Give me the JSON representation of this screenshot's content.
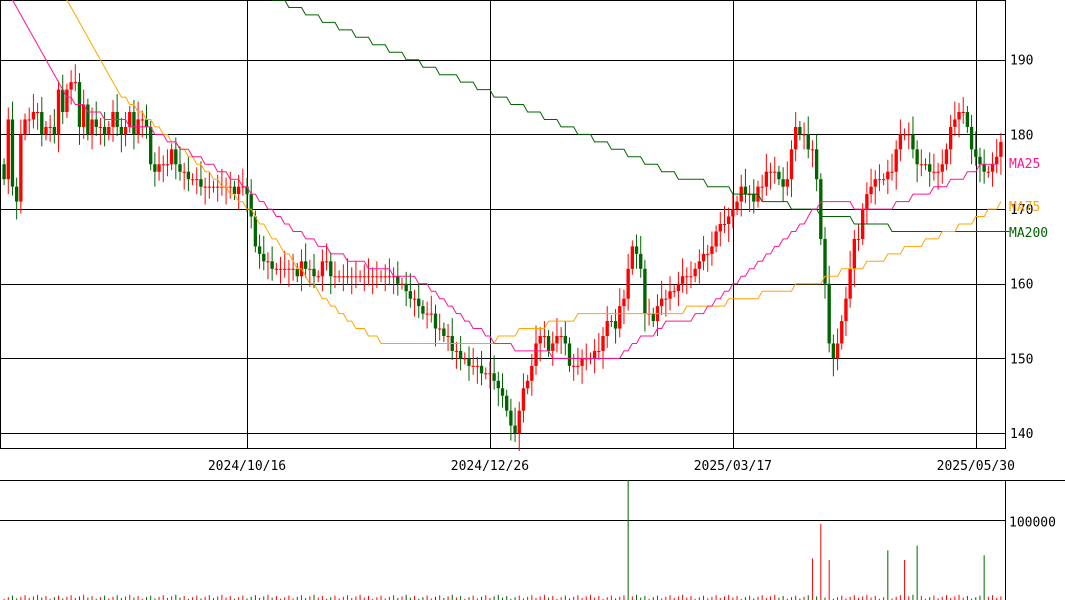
{
  "chart_data": [
    {
      "type": "candlestick",
      "panel": "price",
      "ylim": [
        138,
        198
      ],
      "y_ticks": [
        140,
        150,
        160,
        170,
        180,
        190
      ],
      "x_tick_labels": [
        {
          "index": 58,
          "label": "2024/10/16"
        },
        {
          "index": 116,
          "label": "2024/12/26"
        },
        {
          "index": 174,
          "label": "2025/03/17"
        },
        {
          "index": 232,
          "label": "2025/05/30"
        }
      ],
      "grid": true,
      "colors": {
        "up": "#ff0000",
        "down": "#006400",
        "ma25": "#ff1493",
        "ma75": "#ffa500",
        "ma200": "#006400",
        "grid": "#000000"
      },
      "legend": [
        {
          "label": "MA25",
          "color": "#ff1493"
        },
        {
          "label": "MA75",
          "color": "#ffa500"
        },
        {
          "label": "MA200",
          "color": "#006400"
        }
      ],
      "closes": [
        174,
        182,
        173,
        171,
        180,
        182,
        182,
        183,
        183,
        180,
        181,
        181,
        180,
        186,
        183,
        186,
        187,
        187,
        181,
        184,
        180,
        182,
        181,
        181,
        180,
        181,
        183,
        181,
        180,
        181,
        183,
        180,
        182,
        182,
        181,
        176,
        175,
        176,
        176,
        176,
        178,
        176,
        175,
        175,
        174,
        174,
        174,
        173,
        173,
        173,
        173,
        173,
        173,
        173,
        173,
        172,
        173,
        173,
        172,
        169,
        165,
        164,
        163,
        163,
        162,
        162,
        162,
        162,
        162,
        162,
        161,
        163,
        162,
        162,
        161,
        161,
        163,
        163,
        161,
        161,
        161,
        161,
        161,
        161,
        161,
        161,
        161,
        161,
        161,
        161,
        161,
        161,
        161,
        161,
        160,
        160,
        159,
        158,
        158,
        157,
        156,
        156,
        156,
        154,
        154,
        153,
        153,
        151,
        151,
        150,
        150,
        149,
        149,
        149,
        148,
        148,
        148,
        147,
        146,
        145,
        143,
        141,
        140,
        143,
        146,
        147,
        149,
        152,
        153,
        153,
        151,
        152,
        153,
        153,
        152,
        149,
        149,
        149,
        150,
        150,
        150,
        151,
        151,
        153,
        155,
        155,
        154,
        157,
        158,
        162,
        165,
        164,
        162,
        156,
        156,
        155,
        157,
        158,
        158,
        159,
        159,
        160,
        161,
        161,
        161,
        162,
        163,
        164,
        164,
        165,
        167,
        168,
        168,
        169,
        170,
        171,
        173,
        172,
        172,
        171,
        173,
        173,
        175,
        175,
        175,
        174,
        173,
        174,
        178,
        181,
        180,
        180,
        178,
        178,
        174,
        166,
        160,
        152,
        150,
        152,
        155,
        158,
        162,
        166,
        166,
        170,
        172,
        173,
        174,
        174,
        174,
        175,
        175,
        178,
        180,
        180,
        180,
        178,
        176,
        176,
        176,
        175,
        175,
        175,
        176,
        178,
        181,
        182,
        183,
        183,
        181,
        178,
        177,
        176,
        175,
        175,
        176,
        177,
        179
      ],
      "ohlc_sample": [
        {
          "o": 180,
          "h": 183,
          "l": 172,
          "c": 174
        },
        {
          "o": 183,
          "h": 187,
          "l": 170,
          "c": 182
        },
        {
          "o": 182,
          "h": 184,
          "l": 171,
          "c": 173
        },
        {
          "o": 173,
          "h": 176,
          "l": 169,
          "c": 171
        }
      ],
      "ma25": [
        200,
        199,
        198,
        197,
        196,
        195,
        194,
        193,
        192,
        191,
        190,
        189,
        188,
        187,
        186,
        185,
        185,
        184,
        184,
        184,
        183,
        183,
        183,
        183,
        182,
        182,
        182,
        182,
        182,
        182,
        181,
        181,
        181,
        181,
        181,
        181,
        180,
        180,
        180,
        179,
        179,
        179,
        178,
        178,
        178,
        177,
        177,
        177,
        176,
        176,
        176,
        175,
        175,
        175,
        174,
        174,
        174,
        173,
        173,
        172,
        172,
        171,
        171,
        170,
        170,
        169,
        169,
        168,
        168,
        167,
        167,
        167,
        166,
        166,
        166,
        165,
        165,
        165,
        164,
        164,
        164,
        164,
        163,
        163,
        163,
        163,
        163,
        162,
        162,
        162,
        162,
        162,
        162,
        161,
        161,
        161,
        161,
        161,
        161,
        160,
        160,
        160,
        159,
        159,
        158,
        158,
        157,
        157,
        156,
        156,
        155,
        155,
        154,
        154,
        154,
        153,
        153,
        152,
        152,
        152,
        152,
        152,
        151,
        151,
        151,
        151,
        151,
        151,
        151,
        151,
        151,
        150,
        150,
        150,
        150,
        150,
        150,
        150,
        150,
        150,
        150,
        150,
        150,
        150,
        150,
        150,
        150,
        150,
        151,
        151,
        152,
        152,
        153,
        153,
        153,
        153,
        154,
        154,
        155,
        155,
        155,
        155,
        155,
        155,
        155,
        156,
        156,
        156,
        157,
        157,
        158,
        158,
        159,
        159,
        160,
        160,
        161,
        161,
        162,
        162,
        163,
        163,
        164,
        164,
        165,
        165,
        166,
        166,
        167,
        167,
        168,
        168,
        169,
        170,
        170,
        171,
        171,
        171,
        171,
        171,
        171,
        171,
        171,
        170,
        170,
        170,
        170,
        170,
        170,
        170,
        170,
        170,
        170,
        171,
        171,
        171,
        171,
        172,
        172,
        172,
        172,
        172,
        173,
        173,
        173,
        173,
        174,
        174,
        174,
        174,
        175,
        175,
        175,
        176,
        176,
        176,
        176,
        176
      ],
      "ma75": [
        213,
        212,
        211,
        210,
        209,
        208,
        207,
        206,
        205,
        204,
        203,
        202,
        201,
        200,
        199,
        198,
        197,
        196,
        195,
        194,
        193,
        192,
        191,
        190,
        189,
        188,
        187,
        186,
        185,
        185,
        184,
        184,
        183,
        183,
        182,
        182,
        181,
        181,
        180,
        180,
        179,
        179,
        178,
        178,
        177,
        177,
        176,
        176,
        175,
        175,
        174,
        174,
        173,
        173,
        172,
        172,
        171,
        171,
        170,
        170,
        169,
        168,
        168,
        167,
        166,
        166,
        165,
        164,
        164,
        163,
        162,
        162,
        161,
        160,
        160,
        159,
        158,
        158,
        157,
        157,
        156,
        156,
        155,
        155,
        154,
        154,
        154,
        153,
        153,
        153,
        152,
        152,
        152,
        152,
        152,
        152,
        152,
        152,
        152,
        152,
        152,
        152,
        152,
        152,
        152,
        152,
        152,
        152,
        152,
        152,
        152,
        152,
        152,
        152,
        152,
        152,
        152,
        152,
        153,
        153,
        153,
        153,
        153,
        154,
        154,
        154,
        154,
        154,
        154,
        154,
        155,
        155,
        155,
        155,
        155,
        155,
        155,
        156,
        156,
        156,
        156,
        156,
        156,
        156,
        156,
        156,
        156,
        156,
        156,
        156,
        156,
        156,
        156,
        156,
        156,
        156,
        156,
        156,
        156,
        156,
        156,
        156,
        156,
        157,
        157,
        157,
        157,
        157,
        157,
        157,
        157,
        157,
        157,
        158,
        158,
        158,
        158,
        158,
        158,
        158,
        158,
        159,
        159,
        159,
        159,
        159,
        159,
        159,
        159,
        160,
        160,
        160,
        160,
        160,
        160,
        160,
        161,
        161,
        161,
        161,
        162,
        162,
        162,
        162,
        162,
        162,
        163,
        163,
        163,
        163,
        163,
        164,
        164,
        164,
        164,
        165,
        165,
        165,
        165,
        165,
        166,
        166,
        166,
        166,
        167,
        167,
        167,
        167,
        168,
        168,
        168,
        168,
        169,
        169,
        169,
        170,
        170,
        170,
        171
      ],
      "ma200": [
        214,
        214,
        214,
        214,
        213,
        213,
        213,
        213,
        212,
        212,
        212,
        212,
        211,
        211,
        211,
        211,
        210,
        210,
        210,
        210,
        209,
        209,
        209,
        209,
        208,
        208,
        208,
        208,
        207,
        207,
        207,
        207,
        206,
        206,
        206,
        206,
        205,
        205,
        205,
        205,
        204,
        204,
        204,
        204,
        203,
        203,
        203,
        203,
        202,
        202,
        202,
        202,
        201,
        201,
        201,
        201,
        200,
        200,
        200,
        200,
        199,
        199,
        199,
        199,
        198,
        198,
        198,
        198,
        197,
        197,
        197,
        197,
        196,
        196,
        196,
        196,
        195,
        195,
        195,
        195,
        194,
        194,
        194,
        194,
        193,
        193,
        193,
        193,
        192,
        192,
        192,
        192,
        191,
        191,
        191,
        191,
        190,
        190,
        190,
        190,
        189,
        189,
        189,
        189,
        188,
        188,
        188,
        188,
        188,
        187,
        187,
        187,
        187,
        186,
        186,
        186,
        186,
        185,
        185,
        185,
        185,
        184,
        184,
        184,
        184,
        183,
        183,
        183,
        183,
        182,
        182,
        182,
        182,
        181,
        181,
        181,
        181,
        180,
        180,
        180,
        180,
        179,
        179,
        179,
        179,
        178,
        178,
        178,
        178,
        177,
        177,
        177,
        177,
        176,
        176,
        176,
        176,
        175,
        175,
        175,
        175,
        174,
        174,
        174,
        174,
        174,
        174,
        174,
        173,
        173,
        173,
        173,
        173,
        173,
        172,
        172,
        172,
        172,
        172,
        172,
        172,
        171,
        171,
        171,
        171,
        171,
        171,
        171,
        170,
        170,
        170,
        170,
        170,
        170,
        170,
        169,
        169,
        169,
        169,
        169,
        169,
        169,
        169,
        168,
        168,
        168,
        168,
        168,
        168,
        168,
        168,
        168,
        167,
        167,
        167,
        167,
        167,
        167,
        167,
        167,
        167,
        167,
        167,
        167,
        167,
        167,
        167,
        167,
        167,
        167,
        167,
        167,
        167,
        167,
        167,
        167,
        167,
        167,
        167,
        167,
        167
      ]
    },
    {
      "type": "bar",
      "panel": "volume",
      "ylim": [
        0,
        150000
      ],
      "y_ticks": [
        100000
      ],
      "tick_labels": [
        "100000"
      ],
      "spikes": [
        {
          "index": 149,
          "value": 150000,
          "up": false
        },
        {
          "index": 193,
          "value": 52000,
          "up": true
        },
        {
          "index": 195,
          "value": 95000,
          "up": true
        },
        {
          "index": 197,
          "value": 50000,
          "up": true
        },
        {
          "index": 211,
          "value": 62000,
          "up": false
        },
        {
          "index": 215,
          "value": 50000,
          "up": true
        },
        {
          "index": 218,
          "value": 68000,
          "up": false
        },
        {
          "index": 234,
          "value": 56000,
          "up": false
        }
      ]
    }
  ],
  "price_axis_labels": [
    "140",
    "150",
    "160",
    "170",
    "180",
    "190"
  ],
  "legend_labels": {
    "ma25": "MA25",
    "ma75": "MA75",
    "ma200": "MA200"
  },
  "date_labels": [
    "2024/10/16",
    "2024/12/26",
    "2025/03/17",
    "2025/05/30"
  ],
  "volume_axis_label": "100000"
}
